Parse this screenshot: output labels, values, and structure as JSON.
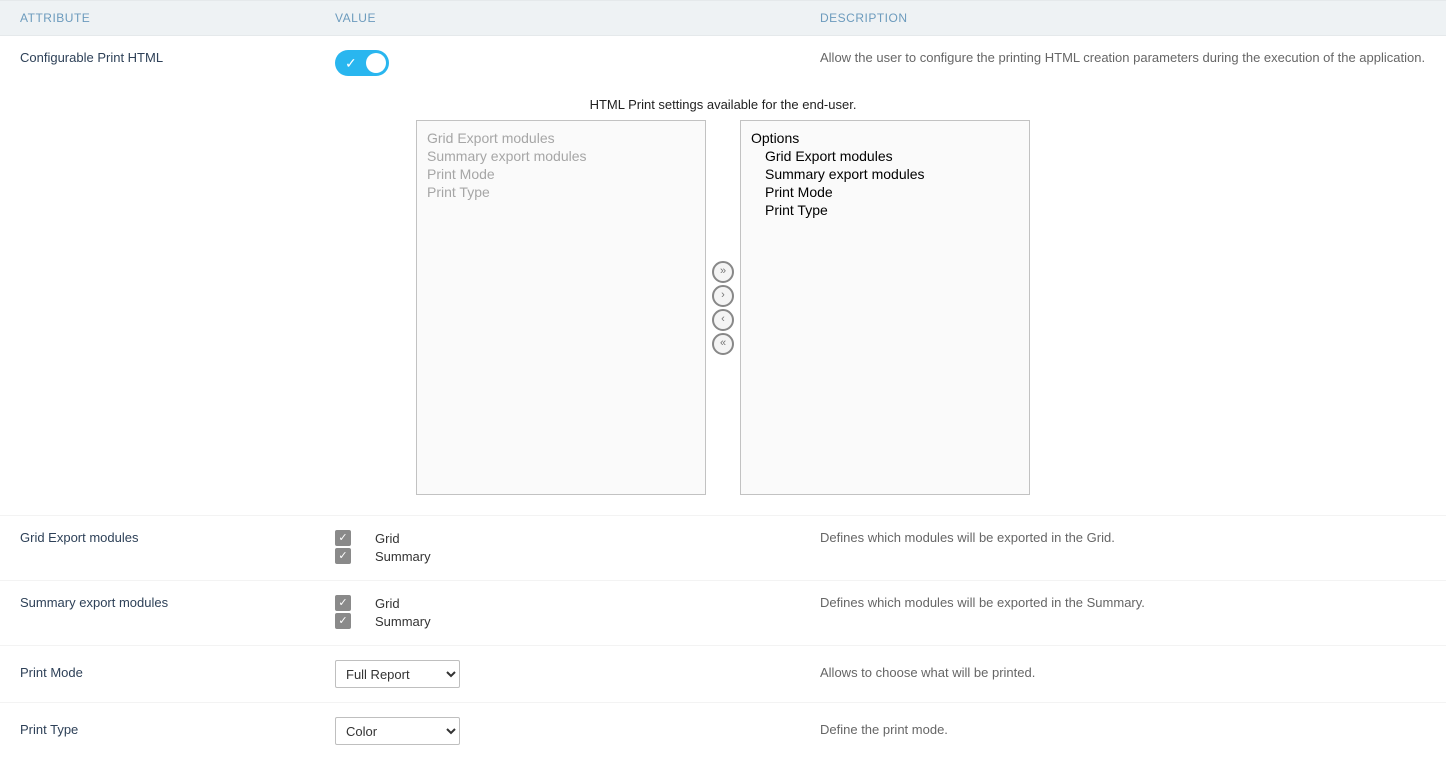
{
  "headers": {
    "attribute": "ATTRIBUTE",
    "value": "VALUE",
    "description": "DESCRIPTION"
  },
  "rows": {
    "configurable": {
      "label": "Configurable Print HTML",
      "toggle_on": true,
      "description": "Allow the user to configure the printing HTML creation parameters during the execution of the application."
    },
    "dualList": {
      "caption": "HTML Print settings available for the end-user.",
      "available": [
        "Grid Export modules",
        "Summary export modules",
        "Print Mode",
        "Print Type"
      ],
      "selectedHeader": "Options",
      "selected": [
        "Grid Export modules",
        "Summary export modules",
        "Print Mode",
        "Print Type"
      ]
    },
    "gridExport": {
      "label": "Grid Export modules",
      "opts": {
        "grid": "Grid",
        "summary": "Summary"
      },
      "description": "Defines which modules will be exported in the Grid."
    },
    "summaryExport": {
      "label": "Summary export modules",
      "opts": {
        "grid": "Grid",
        "summary": "Summary"
      },
      "description": "Defines which modules will be exported in the Summary."
    },
    "printMode": {
      "label": "Print Mode",
      "value": "Full Report",
      "description": "Allows to choose what will be printed."
    },
    "printType": {
      "label": "Print Type",
      "value": "Color",
      "description": "Define the print mode."
    }
  }
}
